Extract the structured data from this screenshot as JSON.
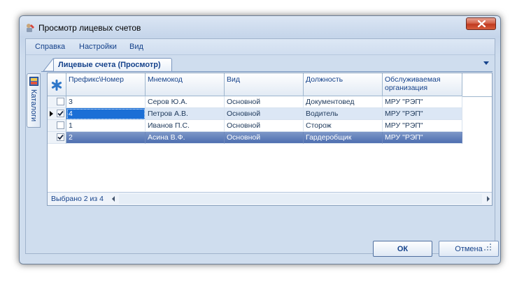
{
  "window": {
    "title": "Просмотр лицевых счетов"
  },
  "menu": {
    "items": [
      "Справка",
      "Настройки",
      "Вид"
    ]
  },
  "side_tab": {
    "label": "Каталоги",
    "icon": "catalog-icon"
  },
  "doc_tab": {
    "label": "Лицевые счета (Просмотр)"
  },
  "grid": {
    "columns": [
      "Префикс\\Номер",
      "Мнемокод",
      "Вид",
      "Должность",
      "Обслуживаемая организация"
    ],
    "rows": [
      {
        "checked": false,
        "current": false,
        "selected": false,
        "cells": [
          "3",
          "Серов Ю.А.",
          "Основной",
          "Документовед",
          "МРУ \"РЭП\""
        ]
      },
      {
        "checked": true,
        "current": true,
        "selected": false,
        "cells": [
          "4",
          "Петров А.В.",
          "Основной",
          "Водитель",
          "МРУ \"РЭП\""
        ]
      },
      {
        "checked": false,
        "current": false,
        "selected": false,
        "cells": [
          "1",
          "Иванов П.С.",
          "Основной",
          "Сторож",
          "МРУ \"РЭП\""
        ]
      },
      {
        "checked": true,
        "current": false,
        "selected": true,
        "cells": [
          "2",
          "Асина В.Ф.",
          "Основной",
          "Гардеробщик",
          "МРУ \"РЭП\""
        ]
      }
    ],
    "footer": "Выбрано 2 из 4"
  },
  "buttons": {
    "ok": "ОК",
    "cancel": "Отмена"
  },
  "colors": {
    "accent": "#15428b",
    "selection": "#4d6eb0",
    "focus": "#1b6fd6",
    "close": "#c0391f"
  }
}
